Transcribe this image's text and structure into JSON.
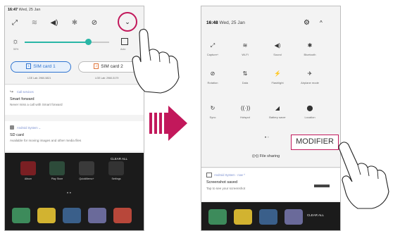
{
  "left_phone": {
    "status_time": "16:47",
    "status_date": "Wed, 25 Jan",
    "brightness_min_label": "50%",
    "auto_label": "Auto",
    "sim_cards": [
      {
        "label": "SIM card 1",
        "sub": "LGE Lab: 2960-5821"
      },
      {
        "label": "SIM card 2",
        "sub": "LGE Lab: 2960-5179"
      }
    ],
    "notifications": [
      {
        "meta": "Call services",
        "title": "Smart forward",
        "text": "Never miss a call with Smart forward"
      },
      {
        "meta": "Android System ⌄",
        "title": "SD card",
        "text": "Available for moving images and other media files"
      }
    ],
    "home_apps": [
      "Album",
      "Play Store",
      "QuickMemo+",
      "Settings"
    ],
    "clear_all": "CLEAR ALL"
  },
  "right_phone": {
    "status_time": "16:48",
    "status_date": "Wed, 25 Jan",
    "tiles": [
      {
        "icon": "⤢",
        "label": "Capture+"
      },
      {
        "icon": "≋",
        "label": "Wi-Fi"
      },
      {
        "icon": "◀)",
        "label": "Sound"
      },
      {
        "icon": "✱",
        "label": "Bluetooth"
      },
      {
        "icon": "⊘",
        "label": "Rotation"
      },
      {
        "icon": "⇅",
        "label": "Data"
      },
      {
        "icon": "⚡",
        "label": "Flashlight"
      },
      {
        "icon": "✈",
        "label": "Airplane mode"
      },
      {
        "icon": "↻",
        "label": "Sync"
      },
      {
        "icon": "((·))",
        "label": "Hotspot"
      },
      {
        "icon": "◢",
        "label": "Battery saver"
      },
      {
        "icon": "⬤",
        "label": "Location"
      }
    ],
    "file_sharing": "File sharing",
    "modifier": "MODIFIER",
    "notification": {
      "meta": "Android System · now ^",
      "title": "Screenshot saved",
      "text": "Tap to see your screenshot"
    },
    "clear_all": "CLEAR ALL"
  },
  "colors": {
    "accent": "#29b6a6",
    "sim_blue": "#2f74d0",
    "sim_orange": "#e0753a",
    "arrow_purple": "#c2185b"
  }
}
